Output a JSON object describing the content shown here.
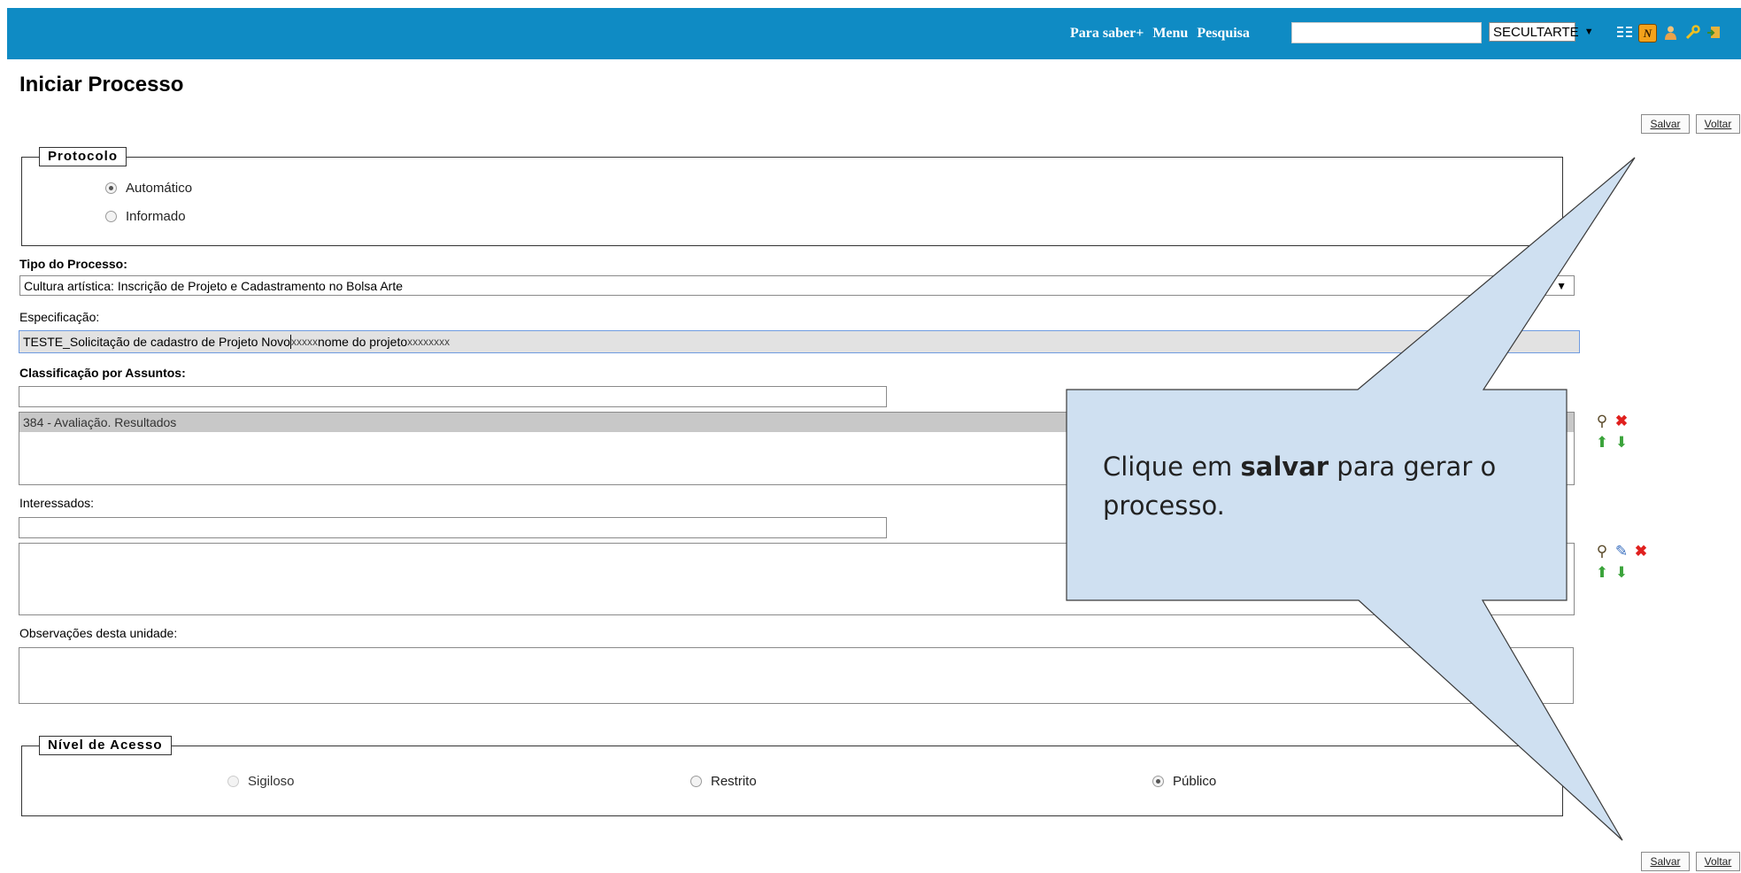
{
  "topbar": {
    "links": [
      "Para saber+",
      "Menu",
      "Pesquisa"
    ],
    "search_value": "",
    "unit_select": "SECULTARTE",
    "icons": [
      "list-icon",
      "n-badge-icon",
      "user-icon",
      "wrench-icon",
      "exit-icon"
    ],
    "bg_color": "#0f8bc4"
  },
  "page": {
    "title": "Iniciar Processo",
    "save_label": "Salvar",
    "back_label": "Voltar"
  },
  "protocolo": {
    "legend": "Protocolo",
    "options": [
      {
        "label": "Automático",
        "checked": true
      },
      {
        "label": "Informado",
        "checked": false
      }
    ]
  },
  "tipo": {
    "label": "Tipo do Processo:",
    "value": "Cultura artística: Inscrição de Projeto e Cadastramento no Bolsa Arte"
  },
  "especificacao": {
    "label": "Especificação:",
    "value_main": "TESTE_Solicitação de cadastro de Projeto Novo",
    "value_x1": "xxxxx",
    "value_name": "nome do projeto",
    "value_x2": "xxxxxxxx"
  },
  "classificacao": {
    "label": "Classificação por Assuntos:",
    "input_value": "",
    "items": [
      "384 - Avaliação. Resultados"
    ]
  },
  "interessados": {
    "label": "Interessados:",
    "input_value": ""
  },
  "observacoes": {
    "label": "Observações desta unidade:",
    "value": ""
  },
  "nivel": {
    "legend": "Nível de Acesso",
    "options": [
      {
        "label": "Sigiloso",
        "checked": false
      },
      {
        "label": "Restrito",
        "checked": false
      },
      {
        "label": "Público",
        "checked": true
      }
    ]
  },
  "callout": {
    "text_before": "Clique em ",
    "text_bold": "salvar",
    "text_after": " para gerar o processo.",
    "fill": "#cfe0f1"
  }
}
